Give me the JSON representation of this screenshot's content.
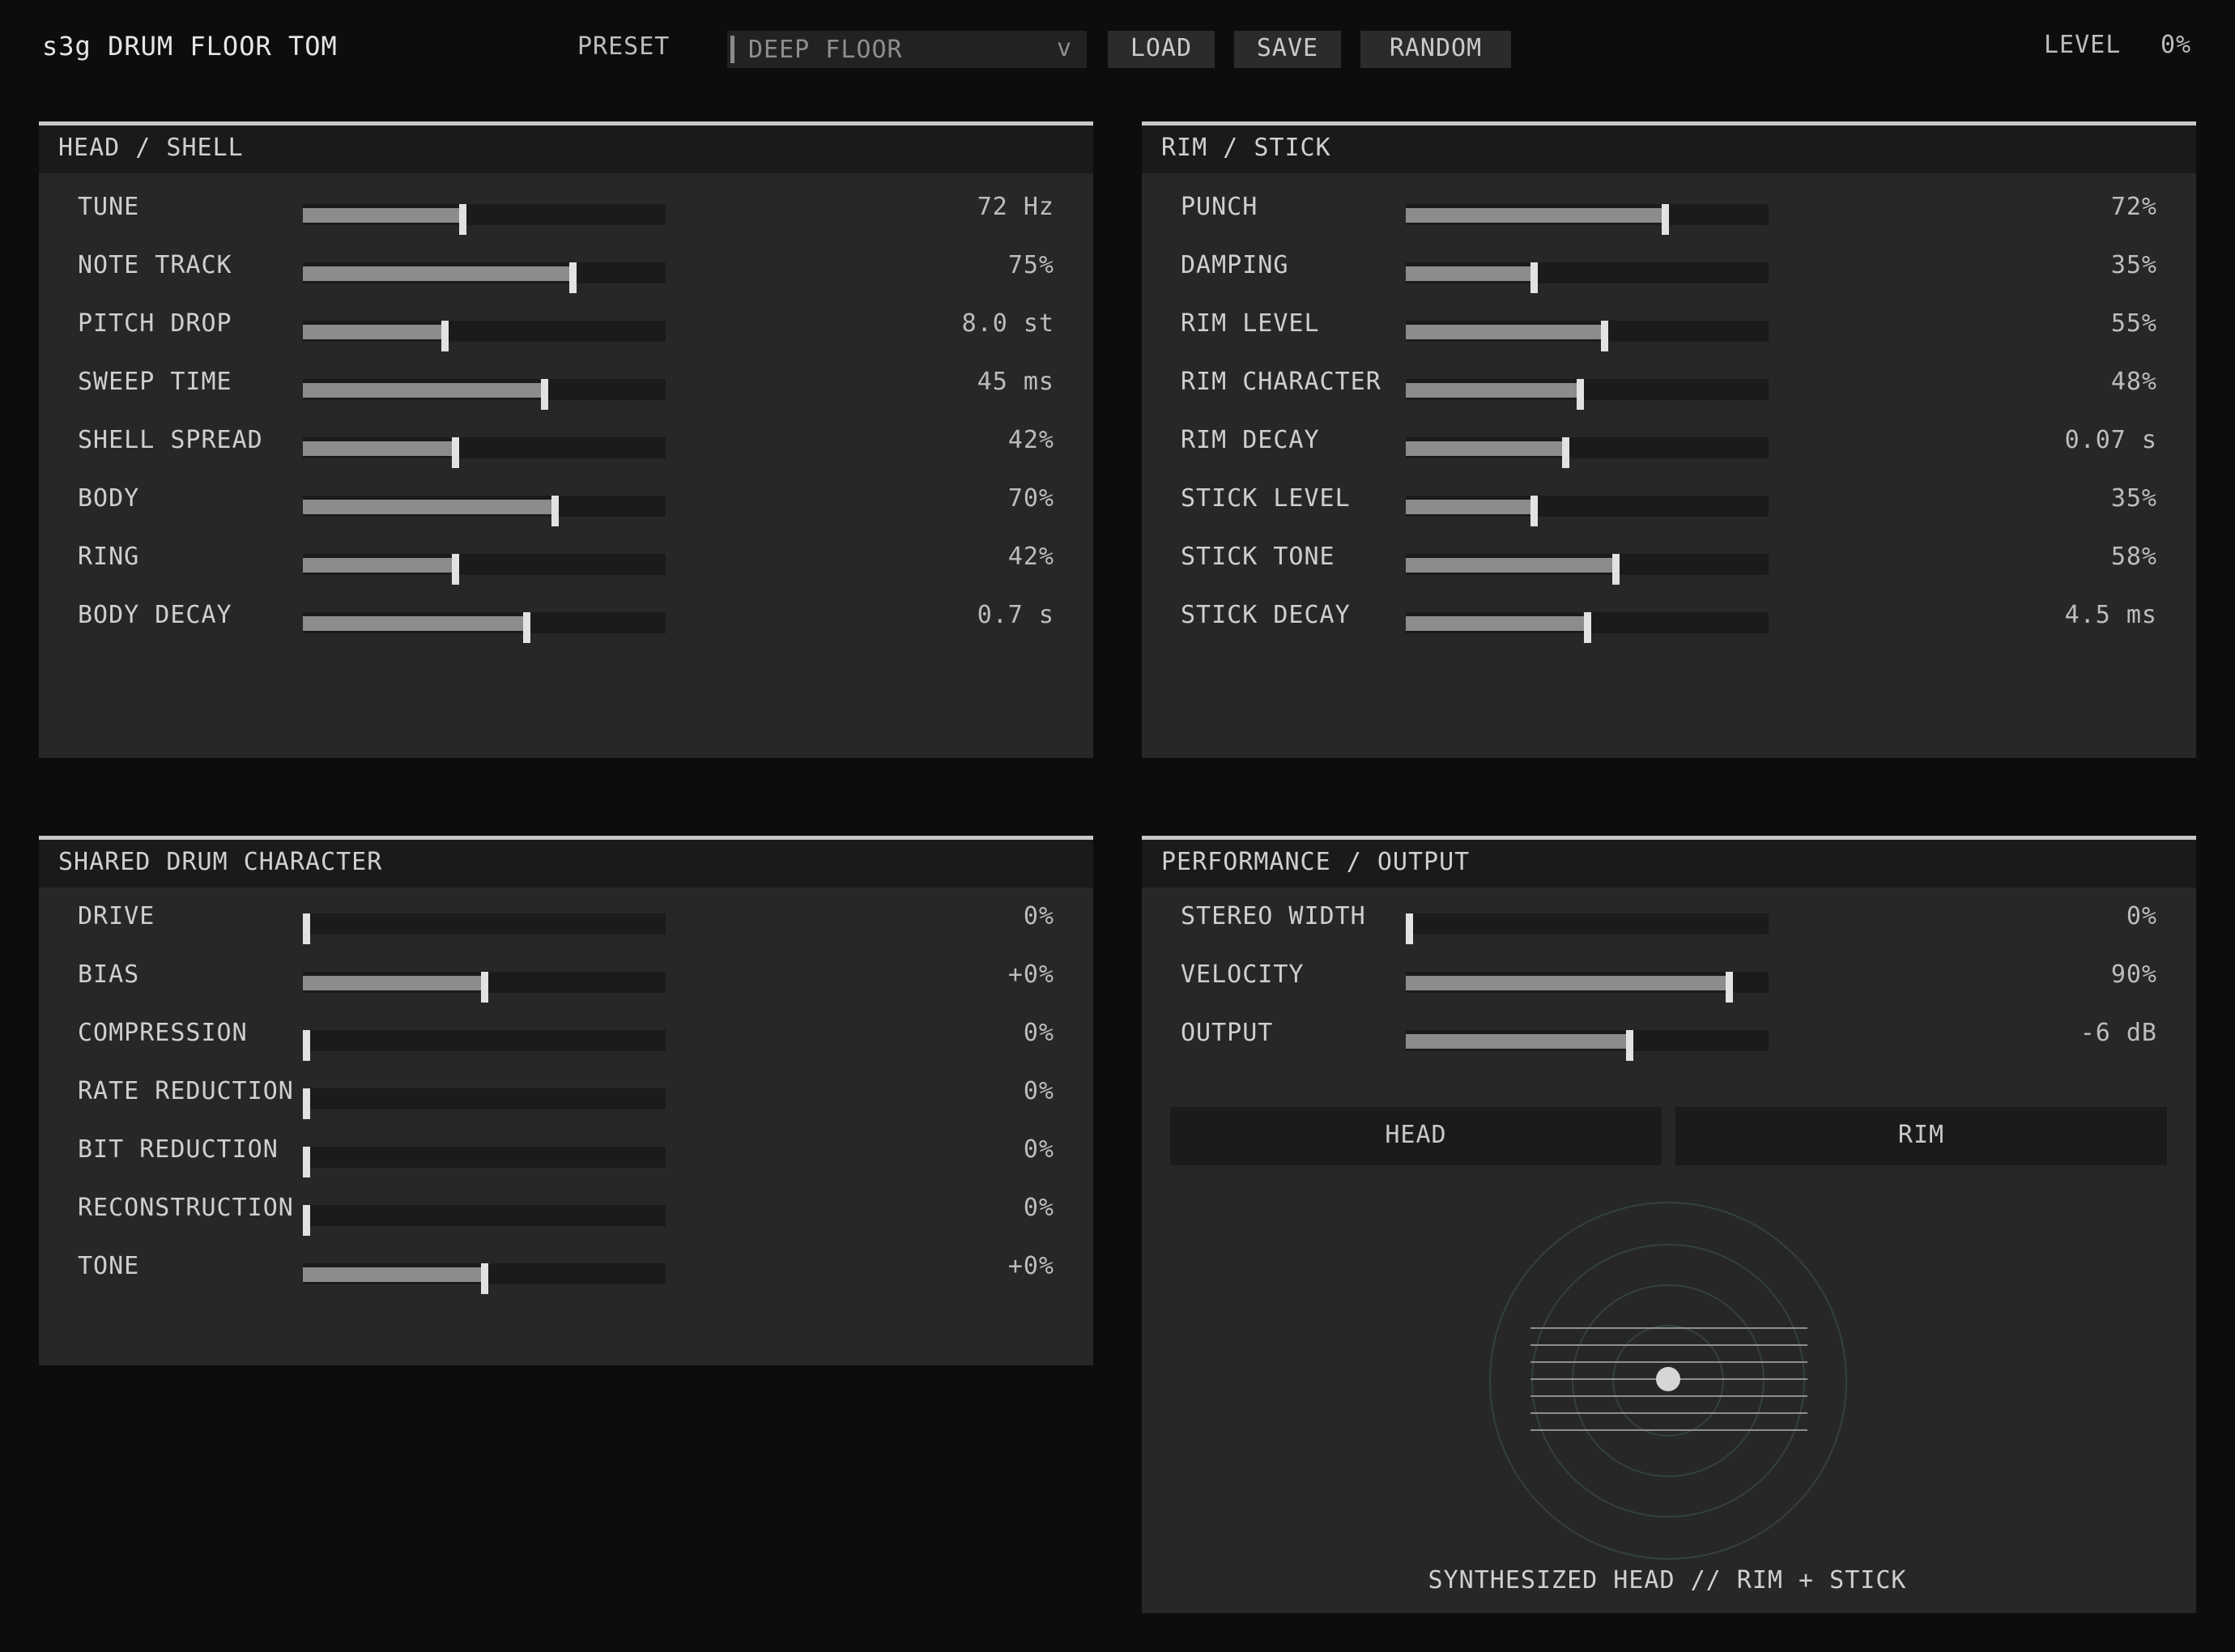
{
  "header": {
    "title": "s3g DRUM FLOOR TOM",
    "preset_label": "PRESET",
    "preset_value": "DEEP FLOOR",
    "preset_chevron": "v",
    "load_label": "LOAD",
    "save_label": "SAVE",
    "random_label": "RANDOM",
    "level_label": "LEVEL",
    "level_value": "0%"
  },
  "panels": {
    "head_shell": {
      "title": "HEAD / SHELL",
      "params": [
        {
          "label": "TUNE",
          "value": "72 Hz",
          "fraction": 0.44
        },
        {
          "label": "NOTE TRACK",
          "value": "75%",
          "fraction": 0.75
        },
        {
          "label": "PITCH DROP",
          "value": "8.0 st",
          "fraction": 0.39
        },
        {
          "label": "SWEEP TIME",
          "value": "45 ms",
          "fraction": 0.67
        },
        {
          "label": "SHELL SPREAD",
          "value": "42%",
          "fraction": 0.42
        },
        {
          "label": "BODY",
          "value": "70%",
          "fraction": 0.7
        },
        {
          "label": "RING",
          "value": "42%",
          "fraction": 0.42
        },
        {
          "label": "BODY DECAY",
          "value": "0.7 s",
          "fraction": 0.62
        }
      ]
    },
    "rim_stick": {
      "title": "RIM / STICK",
      "params": [
        {
          "label": "PUNCH",
          "value": "72%",
          "fraction": 0.72
        },
        {
          "label": "DAMPING",
          "value": "35%",
          "fraction": 0.35
        },
        {
          "label": "RIM LEVEL",
          "value": "55%",
          "fraction": 0.55
        },
        {
          "label": "RIM CHARACTER",
          "value": "48%",
          "fraction": 0.48
        },
        {
          "label": "RIM DECAY",
          "value": "0.07 s",
          "fraction": 0.44
        },
        {
          "label": "STICK LEVEL",
          "value": "35%",
          "fraction": 0.35
        },
        {
          "label": "STICK TONE",
          "value": "58%",
          "fraction": 0.58
        },
        {
          "label": "STICK DECAY",
          "value": "4.5 ms",
          "fraction": 0.5
        }
      ]
    },
    "shared": {
      "title": "SHARED DRUM CHARACTER",
      "params": [
        {
          "label": "DRIVE",
          "value": "0%",
          "fraction": 0.0
        },
        {
          "label": "BIAS",
          "value": "+0%",
          "fraction": 0.5
        },
        {
          "label": "COMPRESSION",
          "value": "0%",
          "fraction": 0.0
        },
        {
          "label": "RATE REDUCTION",
          "value": "0%",
          "fraction": 0.0
        },
        {
          "label": "BIT REDUCTION",
          "value": "0%",
          "fraction": 0.0
        },
        {
          "label": "RECONSTRUCTION",
          "value": "0%",
          "fraction": 0.0
        },
        {
          "label": "TONE",
          "value": "+0%",
          "fraction": 0.5
        }
      ]
    },
    "performance": {
      "title": "PERFORMANCE / OUTPUT",
      "params": [
        {
          "label": "STEREO WIDTH",
          "value": "0%",
          "fraction": 0.0
        },
        {
          "label": "VELOCITY",
          "value": "90%",
          "fraction": 0.9
        },
        {
          "label": "OUTPUT",
          "value": "-6 dB",
          "fraction": 0.62
        }
      ],
      "tab_head": "HEAD",
      "tab_rim": "RIM",
      "caption": "SYNTHESIZED HEAD  //  RIM + STICK"
    }
  },
  "colors": {
    "background": "#0d0d0d",
    "panel": "#272727",
    "panel_header": "#1a1a1a",
    "slider_fill": "#8c8c8c",
    "slider_knob": "#e2e2e2",
    "drum_ring": "#3a4a44"
  }
}
